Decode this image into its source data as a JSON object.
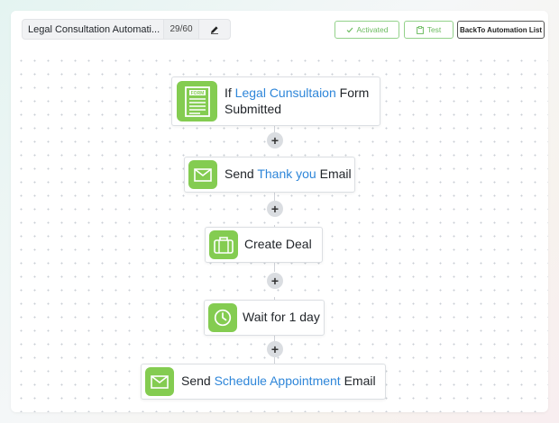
{
  "header": {
    "title": "Legal Consultation Automati...",
    "count": "29/60",
    "activated_label": "Activated",
    "test_label": "Test",
    "back_label": "BackTo Automation List"
  },
  "nodes": [
    {
      "prefix": "If ",
      "highlight": "Legal Cunsultaion",
      "suffix": " Form",
      "line2": "Submitted",
      "icon": "form-icon",
      "icon_label": "FORM"
    },
    {
      "prefix": "Send ",
      "highlight": "Thank you",
      "suffix": " Email",
      "icon": "envelope-icon"
    },
    {
      "text": "Create Deal",
      "icon": "briefcase-icon"
    },
    {
      "text": "Wait for 1 day",
      "icon": "clock-icon"
    },
    {
      "prefix": "Send ",
      "highlight": "Schedule Appointment",
      "suffix": " Email",
      "icon": "envelope-icon"
    }
  ],
  "add_step_label": "+",
  "colors": {
    "accent_green": "#84cc51",
    "highlight_blue": "#2e86d9",
    "button_green": "#6cbc60"
  }
}
